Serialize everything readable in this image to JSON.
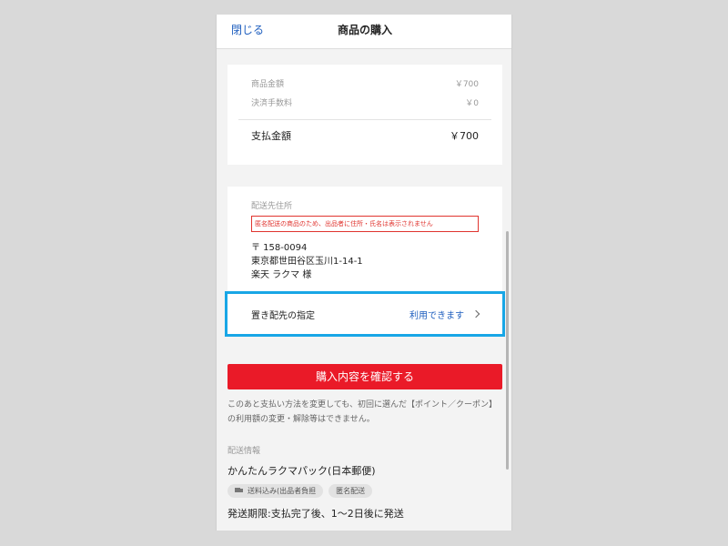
{
  "header": {
    "close_label": "閉じる",
    "title": "商品の購入"
  },
  "summary": {
    "item_price_label": "商品金額",
    "item_price_value": "￥700",
    "fee_label": "決済手数料",
    "fee_value": "￥0",
    "total_label": "支払金額",
    "total_value": "￥700"
  },
  "address": {
    "label": "配送先住所",
    "notice": "匿名配送の商品のため、出品者に住所・氏名は表示されません",
    "postal": "〒 158-0094",
    "street": "東京都世田谷区玉川1-14-1",
    "name": "楽天 ラクマ 様"
  },
  "okihai": {
    "label": "置き配先の指定",
    "value": "利用できます"
  },
  "confirm_button": "購入内容を確認する",
  "note": "このあと支払い方法を変更しても、初回に選んだ【ポイント／クーポン】の利用額の変更・解除等はできません。",
  "shipping": {
    "label": "配送情報",
    "method": "かんたんラクマパック(日本郵便)",
    "badges": [
      "送料込み(出品者負担",
      "匿名配送"
    ],
    "deadline": "発送期限:支払完了後、1〜2日後に発送"
  },
  "colors": {
    "accent_red": "#ea1a28",
    "link_blue": "#1f5fbf",
    "highlight_blue": "#18a6e6",
    "notice_red": "#e0342f"
  }
}
